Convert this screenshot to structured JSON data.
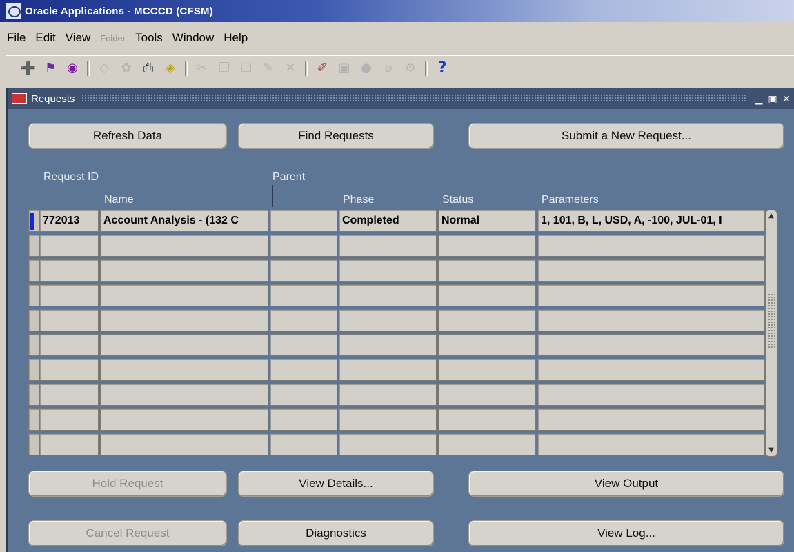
{
  "window": {
    "title": "Oracle Applications - MCCCD (CFSM)"
  },
  "menu": [
    {
      "label": "File",
      "disabled": false
    },
    {
      "label": "Edit",
      "disabled": false
    },
    {
      "label": "View",
      "disabled": false
    },
    {
      "label": "Folder",
      "disabled": true
    },
    {
      "label": "Tools",
      "disabled": false
    },
    {
      "label": "Window",
      "disabled": false
    },
    {
      "label": "Help",
      "disabled": false
    }
  ],
  "toolbar": {
    "help_glyph": "?"
  },
  "form": {
    "title": "Requests",
    "buttons": {
      "refresh": "Refresh Data",
      "find": "Find Requests",
      "submit": "Submit a New Request...",
      "hold": "Hold Request",
      "view_details": "View Details...",
      "view_output": "View Output",
      "cancel": "Cancel Request",
      "diagnostics": "Diagnostics",
      "view_log": "View Log..."
    },
    "columns": {
      "request_id": "Request ID",
      "name": "Name",
      "parent": "Parent",
      "phase": "Phase",
      "status": "Status",
      "parameters": "Parameters"
    },
    "rows": [
      {
        "request_id": "772013",
        "name": "Account Analysis - (132 C",
        "parent": "",
        "phase": "Completed",
        "status": "Normal",
        "parameters": "1, 101, B, L, USD, A, -100, JUL-01, I"
      }
    ],
    "empty_rows": 9
  },
  "colors": {
    "title_gradient_start": "#1c2f8a",
    "form_background": "#5d7695",
    "current_record_marker": "#1426d6"
  }
}
